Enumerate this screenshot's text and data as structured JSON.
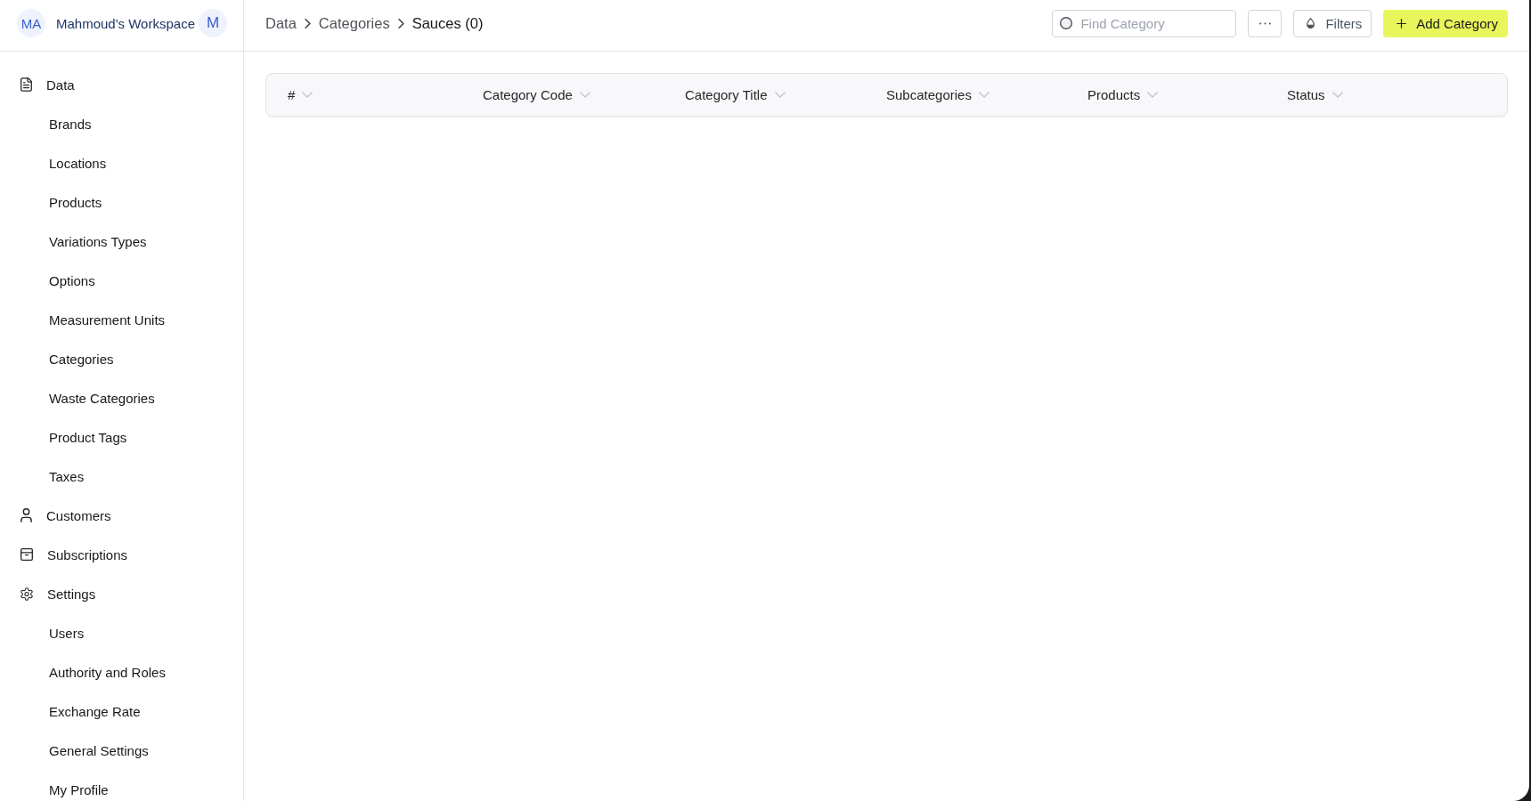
{
  "workspace": {
    "initials": "MA",
    "name": "Mahmoud's Workspace",
    "user_initial": "M"
  },
  "sidebar": {
    "items": [
      {
        "label": "Data",
        "children": [
          {
            "label": "Brands"
          },
          {
            "label": "Locations"
          },
          {
            "label": "Products"
          },
          {
            "label": "Variations Types"
          },
          {
            "label": "Options"
          },
          {
            "label": "Measurement Units"
          },
          {
            "label": "Categories"
          },
          {
            "label": "Waste Categories"
          },
          {
            "label": "Product Tags"
          },
          {
            "label": "Taxes"
          }
        ]
      },
      {
        "label": "Customers"
      },
      {
        "label": "Subscriptions"
      },
      {
        "label": "Settings",
        "children": [
          {
            "label": "Users"
          },
          {
            "label": "Authority and Roles"
          },
          {
            "label": "Exchange Rate"
          },
          {
            "label": "General Settings"
          },
          {
            "label": "My Profile"
          }
        ]
      }
    ]
  },
  "breadcrumb": [
    {
      "label": "Data",
      "current": false
    },
    {
      "label": "Categories",
      "current": false
    },
    {
      "label": "Sauces (0)",
      "current": true
    }
  ],
  "toolbar": {
    "search": {
      "placeholder": "Find Category"
    },
    "filters_label": "Filters",
    "add_label": "Add Category"
  },
  "table": {
    "columns": [
      {
        "label": "#"
      },
      {
        "label": "Category Code"
      },
      {
        "label": "Category Title"
      },
      {
        "label": "Subcategories"
      },
      {
        "label": "Products"
      },
      {
        "label": "Status"
      }
    ]
  }
}
